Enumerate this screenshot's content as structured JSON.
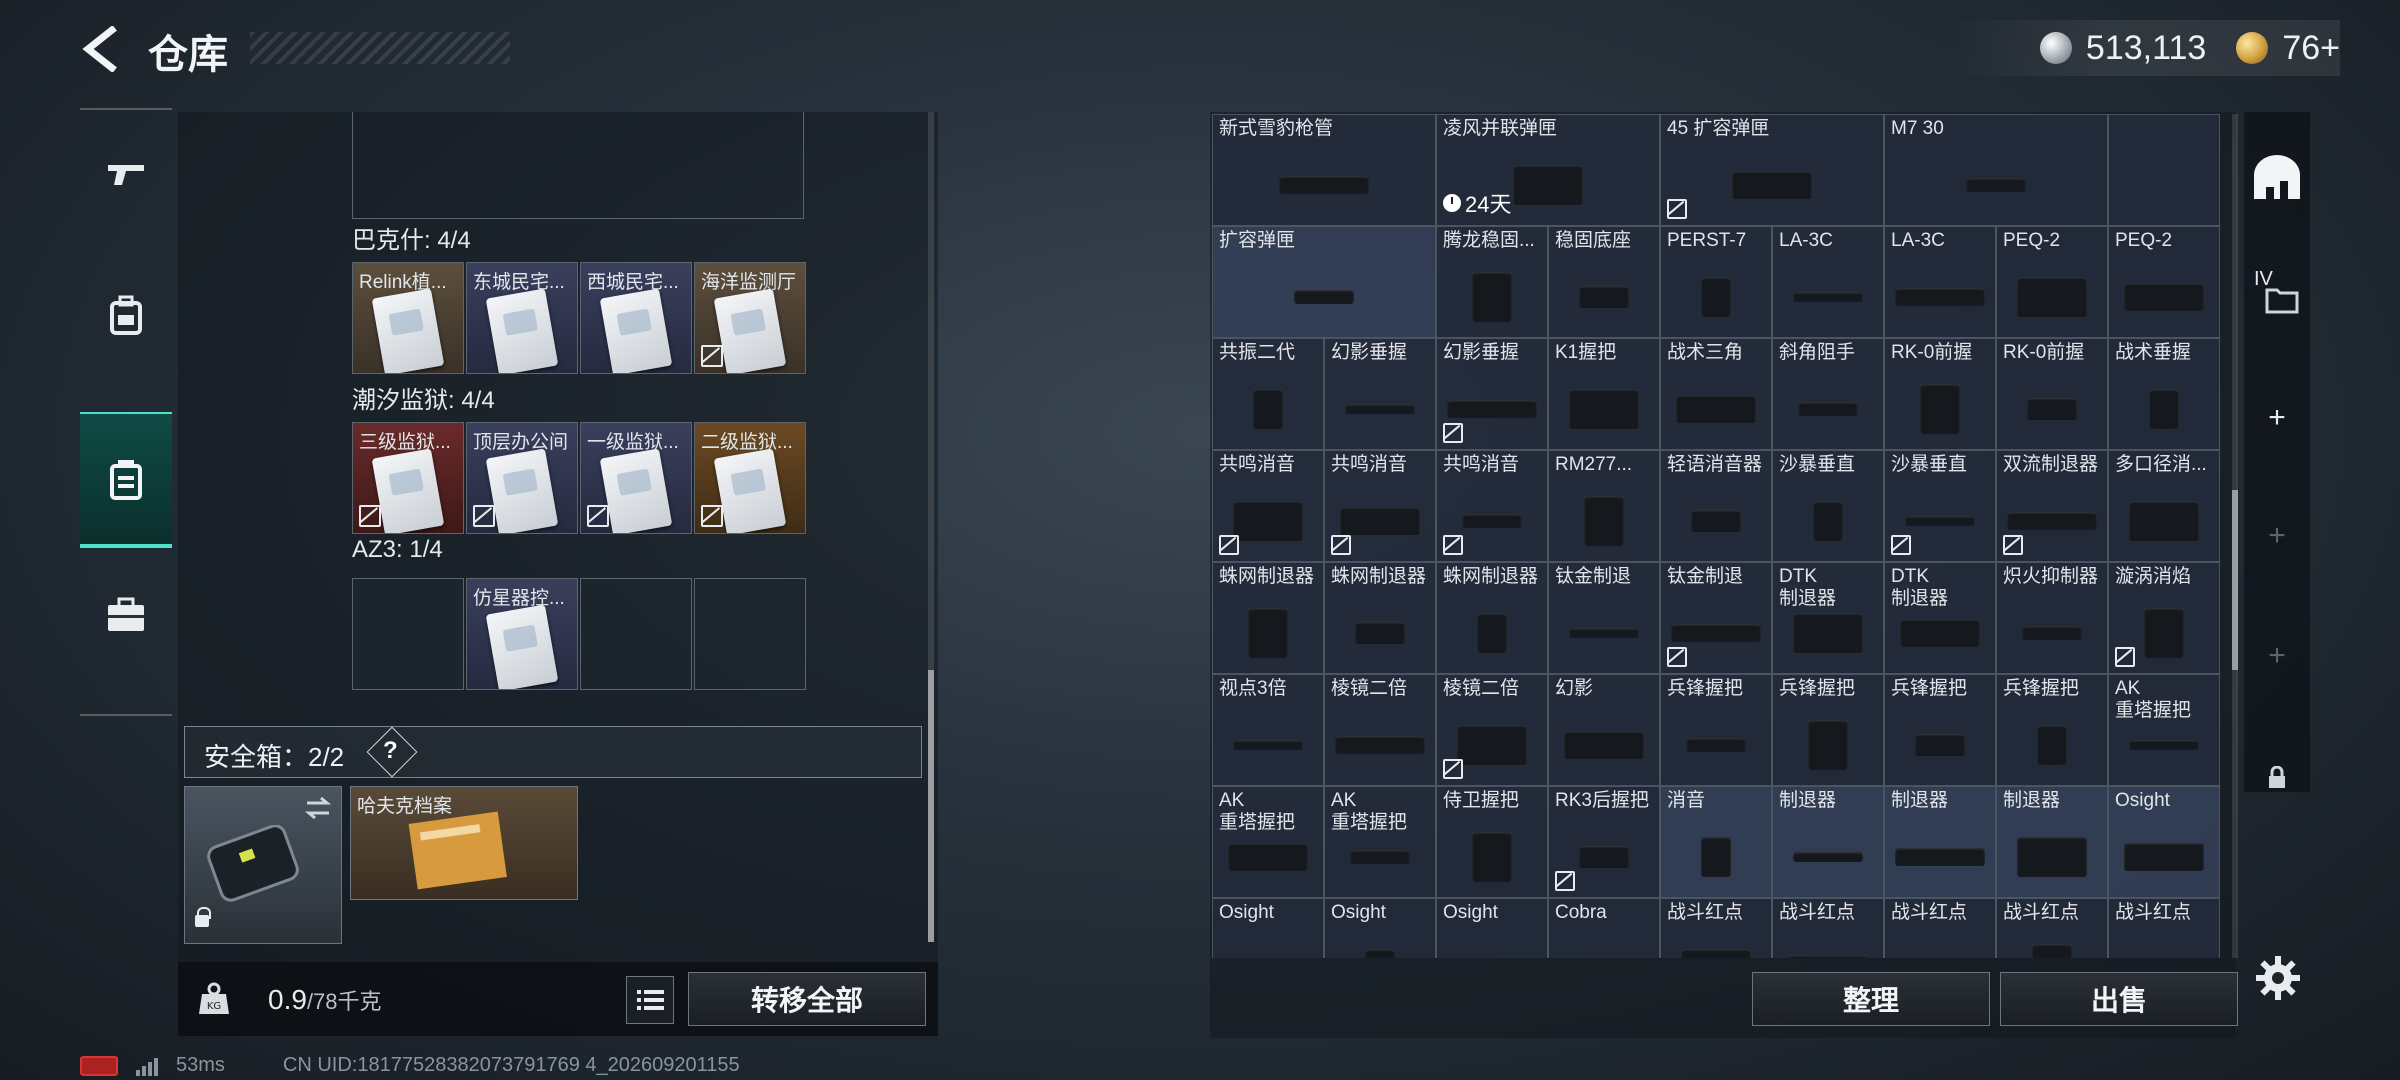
{
  "header": {
    "title": "仓库",
    "silver_amount": "513,113",
    "gold_amount": "76+"
  },
  "left_nav": {
    "items": [
      "weapon-icon",
      "backpack-icon",
      "storage-icon",
      "briefcase-icon"
    ],
    "active": "storage-icon"
  },
  "sections": [
    {
      "title": "巴克什: 4/4",
      "slots": [
        {
          "label": "Relink植...",
          "color": "tan",
          "locked": false
        },
        {
          "label": "东城民宅...",
          "color": "blue",
          "locked": false
        },
        {
          "label": "西城民宅...",
          "color": "blue",
          "locked": false
        },
        {
          "label": "海洋监测厅",
          "color": "tan",
          "locked": true
        }
      ]
    },
    {
      "title": "潮汐监狱: 4/4",
      "slots": [
        {
          "label": "三级监狱...",
          "color": "red",
          "locked": true
        },
        {
          "label": "顶层办公间",
          "color": "blue",
          "locked": true
        },
        {
          "label": "一级监狱...",
          "color": "blue",
          "locked": true
        },
        {
          "label": "二级监狱...",
          "color": "gold",
          "locked": true
        }
      ]
    },
    {
      "title": "AZ3: 1/4",
      "slots": [
        {
          "label": "",
          "color": "empty",
          "locked": false
        },
        {
          "label": "仿星器控...",
          "color": "blue",
          "locked": false
        },
        {
          "label": "",
          "color": "empty",
          "locked": false
        },
        {
          "label": "",
          "color": "empty",
          "locked": false
        }
      ]
    }
  ],
  "safebox": {
    "title": "安全箱：2/2",
    "help": "?",
    "file_label": "哈夫克档案"
  },
  "bottom_left": {
    "weight": "0.9",
    "weight_max": "/78千克",
    "transfer_label": "转移全部"
  },
  "grid_rows": [
    [
      {
        "label": "新式雪豹枪管",
        "w": 1,
        "lit": false,
        "lock": false
      },
      {
        "label": "凌风并联弹匣",
        "w": 1,
        "lit": false,
        "lock": false,
        "timer": "24天"
      },
      {
        "label": "45 扩容弹匣",
        "w": 1,
        "lit": false,
        "lock": true
      },
      {
        "label": "M7 30",
        "w": 1,
        "lit": false,
        "lock": false
      },
      {
        "label": "",
        "w": 1,
        "lit": false,
        "lock": false
      }
    ],
    [
      {
        "label": "扩容弹匣",
        "w": 2,
        "lit": true,
        "lock": false
      },
      {
        "label": "腾龙稳固...",
        "w": 1,
        "lit": false,
        "lock": false
      },
      {
        "label": "稳固底座",
        "w": 1,
        "lit": false,
        "lock": false
      },
      {
        "label": "PERST-7",
        "w": 1,
        "lit": false,
        "lock": false
      },
      {
        "label": "LA-3C",
        "w": 1,
        "lit": false,
        "lock": false
      },
      {
        "label": "LA-3C",
        "w": 1,
        "lit": false,
        "lock": false
      },
      {
        "label": "PEQ-2",
        "w": 1,
        "lit": false,
        "lock": false
      },
      {
        "label": "PEQ-2",
        "w": 1,
        "lit": false,
        "lock": false
      }
    ],
    [
      {
        "label": "共振二代",
        "w": 1,
        "lit": false,
        "lock": false
      },
      {
        "label": "幻影垂握",
        "w": 1,
        "lit": false,
        "lock": false
      },
      {
        "label": "幻影垂握",
        "w": 1,
        "lit": false,
        "lock": true
      },
      {
        "label": "K1握把",
        "w": 1,
        "lit": false,
        "lock": false
      },
      {
        "label": "战术三角",
        "w": 1,
        "lit": false,
        "lock": false
      },
      {
        "label": "斜角阻手",
        "w": 1,
        "lit": false,
        "lock": false
      },
      {
        "label": "RK-0前握",
        "w": 1,
        "lit": false,
        "lock": false
      },
      {
        "label": "RK-0前握",
        "w": 1,
        "lit": false,
        "lock": false
      },
      {
        "label": "战术垂握",
        "w": 1,
        "lit": false,
        "lock": false
      }
    ],
    [
      {
        "label": "共鸣消音",
        "w": 1,
        "lit": false,
        "lock": true
      },
      {
        "label": "共鸣消音",
        "w": 1,
        "lit": false,
        "lock": true
      },
      {
        "label": "共鸣消音",
        "w": 1,
        "lit": false,
        "lock": true
      },
      {
        "label": "RM277...",
        "w": 1,
        "lit": false,
        "lock": false
      },
      {
        "label": "轻语消音器",
        "w": 1,
        "lit": false,
        "lock": false
      },
      {
        "label": "沙暴垂直",
        "w": 1,
        "lit": false,
        "lock": false
      },
      {
        "label": "沙暴垂直",
        "w": 1,
        "lit": false,
        "lock": true
      },
      {
        "label": "双流制退器",
        "w": 1,
        "lit": false,
        "lock": true
      },
      {
        "label": "多口径消...",
        "w": 1,
        "lit": false,
        "lock": false
      }
    ],
    [
      {
        "label": "蛛网制退器",
        "w": 1,
        "lit": false,
        "lock": false
      },
      {
        "label": "蛛网制退器",
        "w": 1,
        "lit": false,
        "lock": false
      },
      {
        "label": "蛛网制退器",
        "w": 1,
        "lit": false,
        "lock": false
      },
      {
        "label": "钛金制退",
        "w": 1,
        "lit": false,
        "lock": false
      },
      {
        "label": "钛金制退",
        "w": 1,
        "lit": false,
        "lock": true
      },
      {
        "label": "DTK\n制退器",
        "w": 1,
        "lit": false,
        "lock": false
      },
      {
        "label": "DTK\n制退器",
        "w": 1,
        "lit": false,
        "lock": false
      },
      {
        "label": "炽火抑制器",
        "w": 1,
        "lit": false,
        "lock": false
      },
      {
        "label": "漩涡消焰",
        "w": 1,
        "lit": false,
        "lock": true
      }
    ],
    [
      {
        "label": "视点3倍",
        "w": 1,
        "lit": false,
        "lock": false
      },
      {
        "label": "棱镜二倍",
        "w": 1,
        "lit": false,
        "lock": false
      },
      {
        "label": "棱镜二倍",
        "w": 1,
        "lit": false,
        "lock": true
      },
      {
        "label": "幻影",
        "w": 1,
        "lit": false,
        "lock": false
      },
      {
        "label": "兵锋握把",
        "w": 1,
        "lit": false,
        "lock": false
      },
      {
        "label": "兵锋握把",
        "w": 1,
        "lit": false,
        "lock": false
      },
      {
        "label": "兵锋握把",
        "w": 1,
        "lit": false,
        "lock": false
      },
      {
        "label": "兵锋握把",
        "w": 1,
        "lit": false,
        "lock": false
      },
      {
        "label": "AK\n重塔握把",
        "w": 1,
        "lit": false,
        "lock": false
      }
    ],
    [
      {
        "label": "AK\n重塔握把",
        "w": 1,
        "lit": false,
        "lock": false
      },
      {
        "label": "AK\n重塔握把",
        "w": 1,
        "lit": false,
        "lock": false
      },
      {
        "label": "侍卫握把",
        "w": 1,
        "lit": false,
        "lock": false
      },
      {
        "label": "RK3后握把",
        "w": 1,
        "lit": false,
        "lock": true
      },
      {
        "label": "消音",
        "w": 1,
        "lit": true,
        "lock": false
      },
      {
        "label": "制退器",
        "w": 1,
        "lit": true,
        "lock": false
      },
      {
        "label": "制退器",
        "w": 1,
        "lit": true,
        "lock": false
      },
      {
        "label": "制退器",
        "w": 1,
        "lit": true,
        "lock": false
      },
      {
        "label": "Osight",
        "w": 1,
        "lit": true,
        "lock": false
      }
    ],
    [
      {
        "label": "Osight",
        "w": 1,
        "lit": false,
        "lock": false
      },
      {
        "label": "Osight",
        "w": 1,
        "lit": false,
        "lock": false
      },
      {
        "label": "Osight",
        "w": 1,
        "lit": false,
        "lock": false
      },
      {
        "label": "Cobra",
        "w": 1,
        "lit": false,
        "lock": false
      },
      {
        "label": "战斗红点",
        "w": 1,
        "lit": false,
        "lock": false
      },
      {
        "label": "战斗红点",
        "w": 1,
        "lit": false,
        "lock": false
      },
      {
        "label": "战斗红点",
        "w": 1,
        "lit": false,
        "lock": false
      },
      {
        "label": "战斗红点",
        "w": 1,
        "lit": false,
        "lock": false
      },
      {
        "label": "战斗红点",
        "w": 1,
        "lit": false,
        "lock": false
      }
    ]
  ],
  "right_actions": {
    "sort_label": "整理",
    "sell_label": "出售"
  },
  "right_nav": {
    "tab_label": "IV"
  },
  "status": {
    "ping": "53ms",
    "uid": "CN UID:18177528382073791769 4_202609201155"
  }
}
